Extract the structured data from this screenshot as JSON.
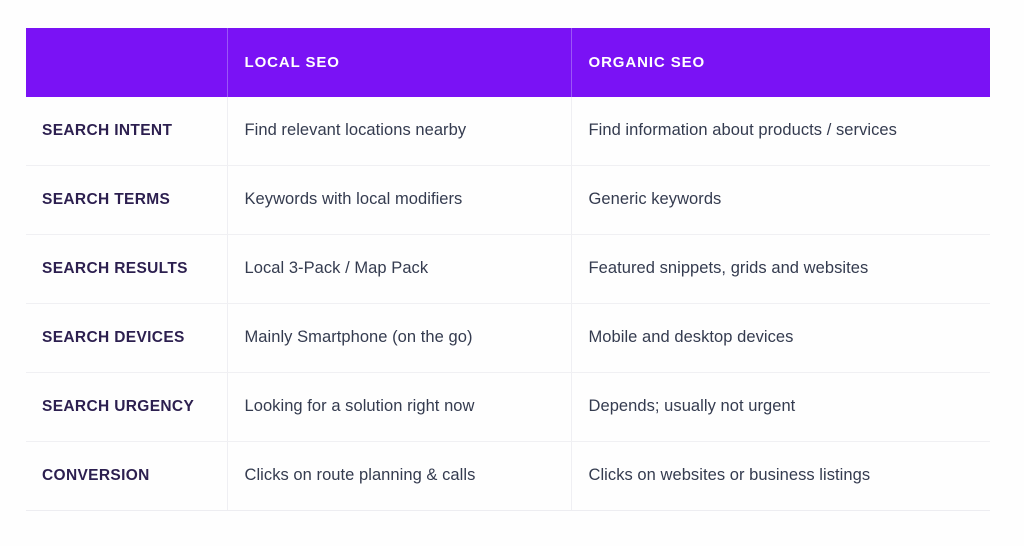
{
  "table": {
    "accent_color": "#7A12F5",
    "header_text_color": "#ffffff",
    "label_text_color": "#2c1f4f",
    "value_text_color": "#343b4f",
    "row_divider_color": "#f0f0f3",
    "background_color": "#fefefe",
    "columns": [
      {
        "key": "attribute",
        "label": ""
      },
      {
        "key": "local_seo",
        "label": "LOCAL SEO"
      },
      {
        "key": "organic_seo",
        "label": "ORGANIC SEO"
      }
    ],
    "rows": [
      {
        "label": "SEARCH INTENT",
        "local_seo": "Find relevant locations nearby",
        "organic_seo": "Find information about products / services"
      },
      {
        "label": "SEARCH TERMS",
        "local_seo": "Keywords with local modifiers",
        "organic_seo": "Generic keywords"
      },
      {
        "label": "SEARCH RESULTS",
        "local_seo": "Local 3-Pack / Map Pack",
        "organic_seo": "Featured snippets, grids and websites"
      },
      {
        "label": "SEARCH DEVICES",
        "local_seo": "Mainly Smartphone (on the go)",
        "organic_seo": "Mobile and desktop devices"
      },
      {
        "label": "SEARCH URGENCY",
        "local_seo": "Looking for a solution right now",
        "organic_seo": "Depends; usually not urgent"
      },
      {
        "label": "CONVERSION",
        "local_seo": "Clicks on route planning & calls",
        "organic_seo": "Clicks on websites or business listings"
      }
    ]
  }
}
